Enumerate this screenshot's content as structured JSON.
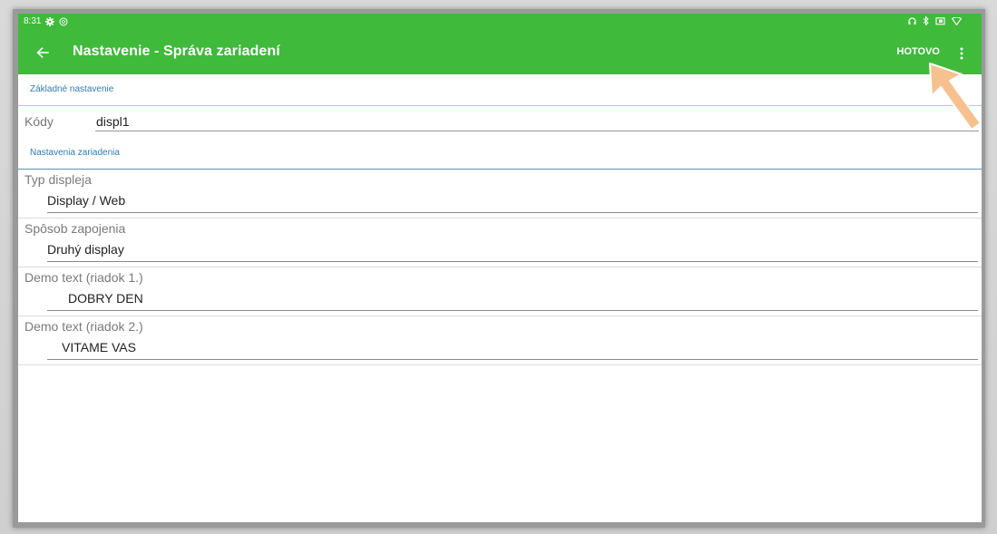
{
  "status_bar": {
    "time": "8:31",
    "left_icons": [
      "gear-icon",
      "sync-icon"
    ],
    "right_icons": [
      "headphones-icon",
      "bluetooth-icon",
      "cast-icon",
      "wifi-icon"
    ]
  },
  "app_bar": {
    "back_icon": "arrow-back-icon",
    "title": "Nastavenie - Správa zariadení",
    "done_label": "HOTOVO",
    "more_icon": "more-vert-icon",
    "background": "#3fba3b"
  },
  "sections": {
    "basic": {
      "header": "Základné nastavenie",
      "codes_label": "Kódy",
      "codes_value": "displ1"
    },
    "device": {
      "header": "Nastavenia zariadenia"
    }
  },
  "preferences": [
    {
      "title": "Typ displeja",
      "value": "Display / Web"
    },
    {
      "title": "Spôsob zapojenia",
      "value": "Druhý display"
    },
    {
      "title": "Demo text (riadok 1.)",
      "value": "DOBRY DEN"
    },
    {
      "title": "Demo text (riadok 2.)",
      "value": "VITAME VAS"
    }
  ],
  "colors": {
    "accent": "#3fba3b",
    "section_text": "#2e7db4",
    "pointer_arrow": "#f6c08f"
  }
}
